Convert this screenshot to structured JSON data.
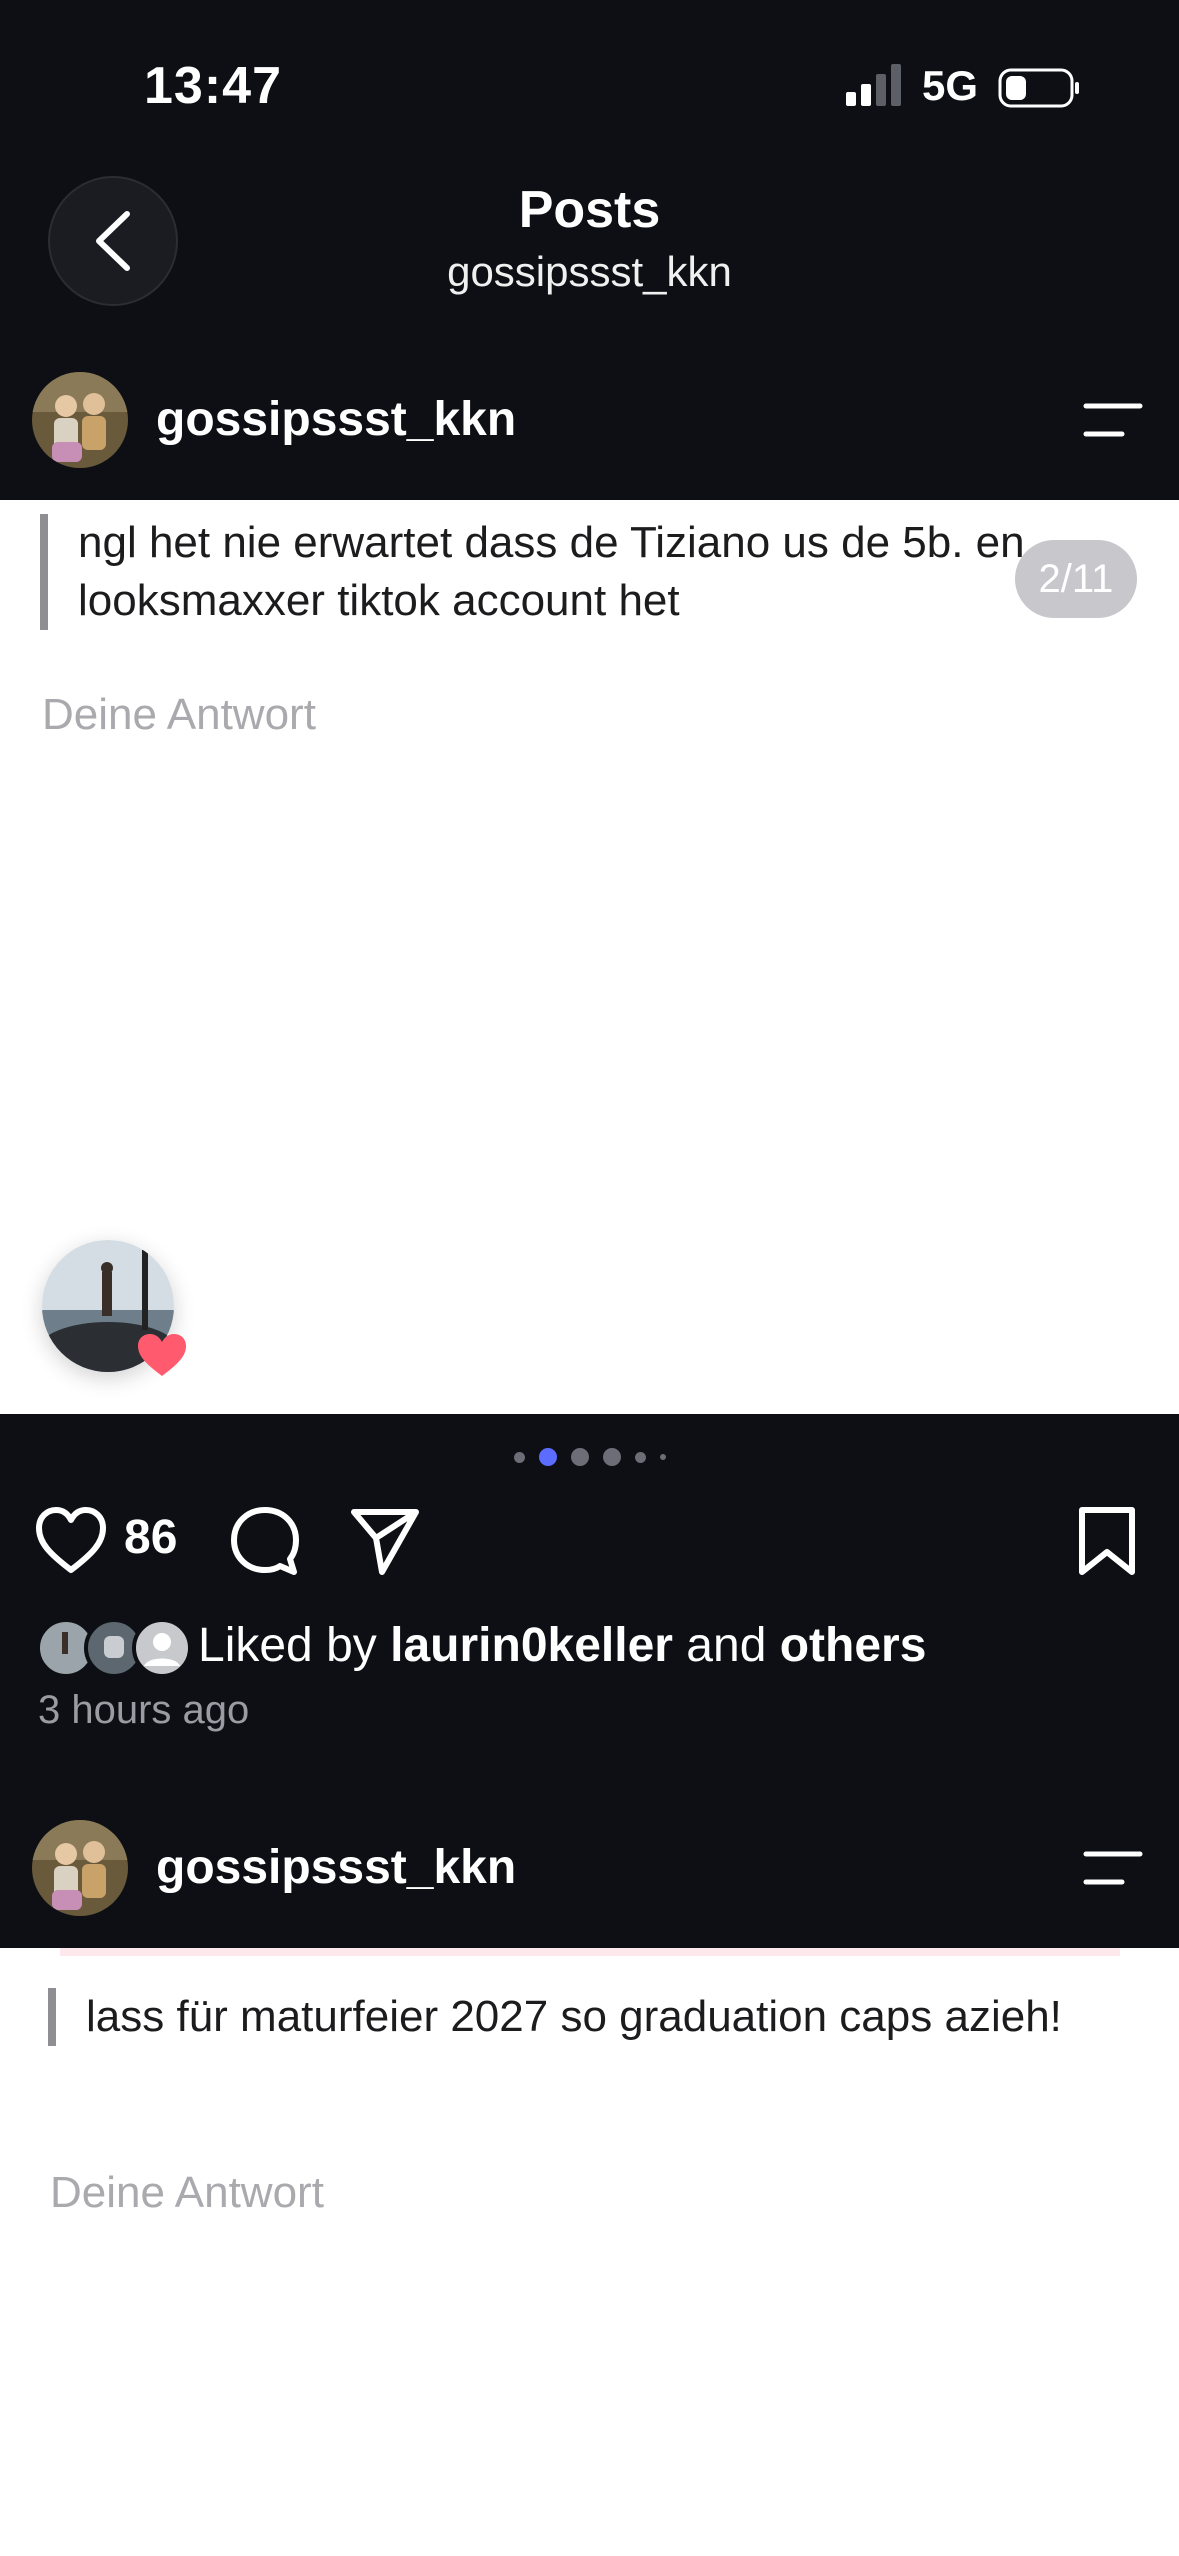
{
  "status": {
    "time": "13:47",
    "network": "5G"
  },
  "header": {
    "title": "Posts",
    "subtitle": "gossipssst_kkn"
  },
  "posts": [
    {
      "username": "gossipssst_kkn",
      "quote": "ngl het nie erwartet dass de Tiziano us de 5b. en looksmaxxer tiktok account het",
      "reply_placeholder": "Deine Antwort",
      "counter": "2/11",
      "likes": "86",
      "liked_prefix": "Liked by",
      "liked_user": "laurin0keller",
      "liked_and": "and",
      "liked_others": "others",
      "time_ago": "3 hours ago",
      "carousel": {
        "active_index": 1,
        "count": 6
      }
    },
    {
      "username": "gossipssst_kkn",
      "quote": "lass für maturfeier 2027 so graduation caps azieh!",
      "reply_placeholder": "Deine Antwort"
    }
  ],
  "colors": {
    "background": "#0d0f14",
    "accent_dot": "#5b6cff",
    "heart": "#ff5a6e"
  },
  "icons": [
    "back-chevron-icon",
    "menu-icon",
    "heart-icon",
    "comment-icon",
    "share-icon",
    "bookmark-icon",
    "signal-icon",
    "battery-icon"
  ]
}
